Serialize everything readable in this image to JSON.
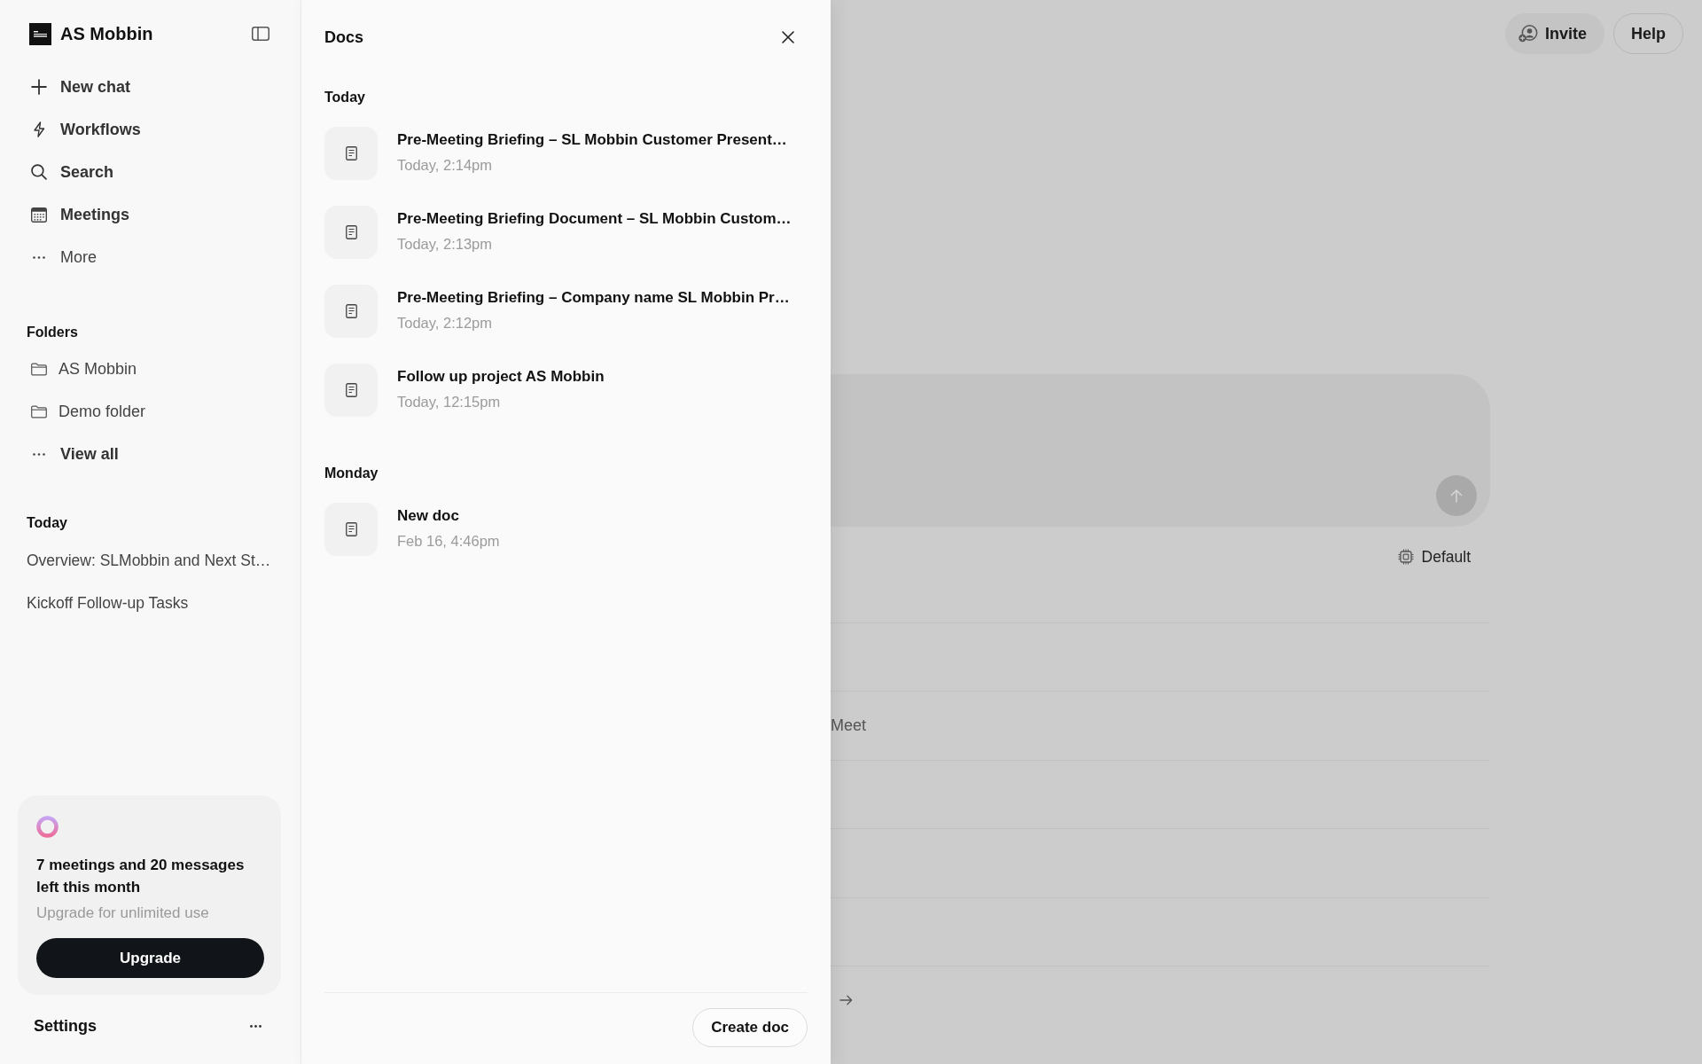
{
  "sidebar": {
    "workspace": {
      "name": "AS Mobbin"
    },
    "nav": [
      {
        "label": "New chat",
        "kind": "new_chat"
      },
      {
        "label": "Workflows",
        "kind": "workflows"
      },
      {
        "label": "Search",
        "kind": "search"
      },
      {
        "label": "Meetings",
        "kind": "meetings"
      },
      {
        "label": "More",
        "kind": "more"
      }
    ],
    "folders": {
      "title": "Folders",
      "items": [
        {
          "label": "AS Mobbin"
        },
        {
          "label": "Demo folder"
        }
      ],
      "view_all": "View all"
    },
    "recent": {
      "title": "Today",
      "items": [
        {
          "label": "Overview: SLMobbin and Next St…"
        },
        {
          "label": "Kickoff Follow-up Tasks"
        }
      ]
    },
    "usage_card": {
      "message": "7 meetings and 20 messages left this month",
      "hint": "Upgrade for unlimited use",
      "button": "Upgrade"
    },
    "settings": {
      "label": "Settings"
    }
  },
  "docs_panel": {
    "title": "Docs",
    "groups": [
      {
        "title": "Today",
        "docs": [
          {
            "title": "Pre-Meeting Briefing – SL Mobbin Customer Present…",
            "time": "Today, 2:14pm"
          },
          {
            "title": "Pre-Meeting Briefing Document – SL Mobbin Custom…",
            "time": "Today, 2:13pm"
          },
          {
            "title": "Pre-Meeting Briefing – Company name SL Mobbin Pr…",
            "time": "Today, 2:12pm"
          },
          {
            "title": "Follow up project AS Mobbin",
            "time": "Today, 12:15pm"
          }
        ]
      },
      {
        "title": "Monday",
        "docs": [
          {
            "title": "New doc",
            "time": "Feb 16, 4:46pm"
          }
        ]
      }
    ],
    "create_button": "Create doc"
  },
  "main": {
    "top_buttons": [
      {
        "label": "Invite",
        "kind": "invite"
      },
      {
        "label": "Help",
        "kind": "help"
      }
    ],
    "model_selector": {
      "label": "Default"
    },
    "list": {
      "row_text": "Meet"
    }
  }
}
